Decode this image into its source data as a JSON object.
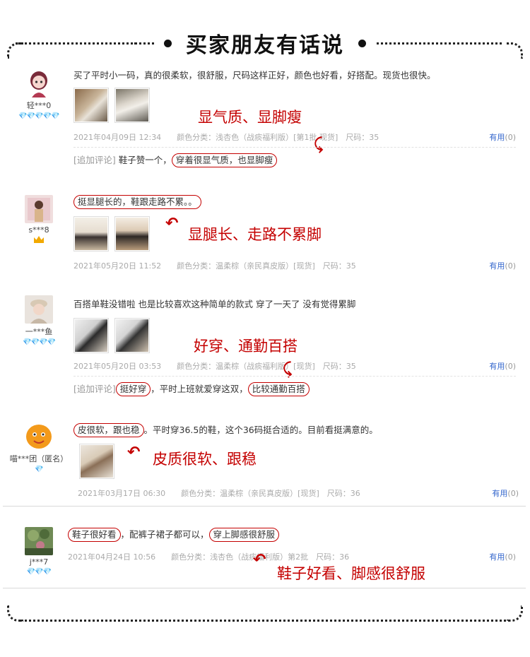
{
  "header": {
    "title": "买家朋友有话说"
  },
  "reviews": [
    {
      "user": "轻***0",
      "badges": "💎💎💎💎💎",
      "text": "买了平时小一码，真的很柔软，很舒服，尺码这样正好，颜色也好看，好搭配。现货也很快。",
      "annotation": "显气质、显脚瘦",
      "meta": "2021年04月09日 12:34　　颜色分类：浅杏色（战痰福利版）[第1批 现货]　尺码：35",
      "useful_label": "有用",
      "useful_count": "(0)",
      "follow_tag": "[追加评论]",
      "follow_pre": "鞋子赞一个，",
      "follow_oval": "穿着很显气质，也显脚瘦"
    },
    {
      "user": "s***8",
      "text_oval": "挺显腿长的，鞋跟走路不累。。",
      "annotation": "显腿长、走路不累脚",
      "meta": "2021年05月20日 11:52　　颜色分类：温柔棕（亲民真皮版）[现货]　尺码：35",
      "useful_label": "有用",
      "useful_count": "(0)"
    },
    {
      "user": "一***鱼",
      "badges": "💎💎💎💎",
      "text": "百搭单鞋没错啦 也是比较喜欢这种简单的款式 穿了一天了 没有觉得累脚",
      "annotation": "好穿、通勤百搭",
      "meta": "2021年05月20日 03:53　　颜色分类：温柔棕（战痰福利版）[现货]　尺码：35",
      "useful_label": "有用",
      "useful_count": "(0)",
      "follow_tag": "[追加评论]",
      "follow_oval1": "挺好穿",
      "follow_mid": "，平时上班就爱穿这双，",
      "follow_oval2": "比较通勤百搭"
    },
    {
      "user": "喵***团（匿名）",
      "badges": "💎",
      "text_oval": "皮很软，跟也稳",
      "text_rest": "。平时穿36.5的鞋，这个36码挺合适的。目前看挺满意的。",
      "annotation": "皮质很软、跟稳",
      "meta": "2021年03月17日 06:30　　颜色分类：温柔棕（亲民真皮版）[现货]　尺码：36",
      "useful_label": "有用",
      "useful_count": "(0)"
    },
    {
      "user": "j***7",
      "badges": "💎💎💎",
      "text_oval1": "鞋子很好看",
      "text_mid": "，配裤子裙子都可以，",
      "text_oval2": "穿上脚感很舒服",
      "annotation": "鞋子好看、脚感很舒服",
      "meta": "2021年04月24日 10:56　　颜色分类：浅杏色（战痰福利版）第2批　尺码：36",
      "useful_label": "有用",
      "useful_count": "(0)"
    }
  ],
  "colors": {
    "accent": "#c40000",
    "link": "#3366cc",
    "badge": "#3aa0e6"
  }
}
